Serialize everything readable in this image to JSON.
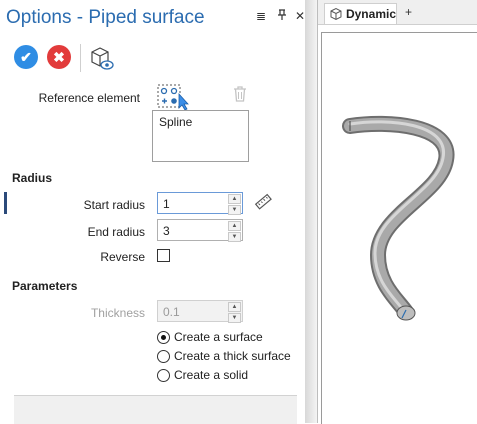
{
  "panel": {
    "title": "Options - Piped surface",
    "header_icons": {
      "menu": "≣",
      "pin": "ᵖ",
      "close": "✕"
    }
  },
  "toolbar": {
    "ok_glyph": "✔",
    "cancel_glyph": "✖"
  },
  "reference": {
    "label": "Reference element",
    "items": [
      "Spline"
    ]
  },
  "radius": {
    "section": "Radius",
    "start_label": "Start radius",
    "start_value": "1",
    "end_label": "End radius",
    "end_value": "3",
    "reverse_label": "Reverse",
    "reverse_checked": false
  },
  "parameters": {
    "section": "Parameters",
    "thickness_label": "Thickness",
    "thickness_value": "0.1",
    "options": [
      {
        "label": "Create a surface",
        "checked": true
      },
      {
        "label": "Create a thick surface",
        "checked": false
      },
      {
        "label": "Create a solid",
        "checked": false
      }
    ]
  },
  "viewport": {
    "tab_label": "Dynamic",
    "add_tab": "+"
  },
  "colors": {
    "accent": "#2b6cb0",
    "ok": "#2f8de4",
    "cancel": "#e23b3b"
  }
}
